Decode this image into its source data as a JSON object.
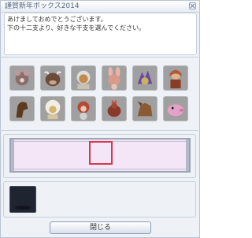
{
  "window": {
    "title": "謹賀新年ボックス2014"
  },
  "message": {
    "line1": "あけましておめでとうございます。",
    "line2": "下の十二支より、好きな干支を選んでください。"
  },
  "zodiac_icons": [
    {
      "icon": "rat-icon",
      "bg": "#9a9a9a",
      "accent": "#8a6d6d"
    },
    {
      "icon": "ox-icon",
      "bg": "#9a9a9a",
      "accent": "#6b4b3a"
    },
    {
      "icon": "tiger-icon",
      "bg": "#9a9a9a",
      "accent": "#c58a48"
    },
    {
      "icon": "rabbit-icon",
      "bg": "#9a9a9a",
      "accent": "#d99a8b"
    },
    {
      "icon": "dragon-icon",
      "bg": "#9a9a9a",
      "accent": "#6a4aa3"
    },
    {
      "icon": "snake-icon",
      "bg": "#9a9a9a",
      "accent": "#b05a3a"
    },
    {
      "icon": "horse-icon",
      "bg": "#9a9a9a",
      "accent": "#5c3a1f"
    },
    {
      "icon": "sheep-icon",
      "bg": "#9a9a9a",
      "accent": "#d7b36b"
    },
    {
      "icon": "monkey-icon",
      "bg": "#9a9a9a",
      "accent": "#b24a3a"
    },
    {
      "icon": "rooster-icon",
      "bg": "#9a9a9a",
      "accent": "#8a3a2a"
    },
    {
      "icon": "dog-icon",
      "bg": "#9a9a9a",
      "accent": "#8a5a34"
    },
    {
      "icon": "boar-icon",
      "bg": "#9a9a9a",
      "accent": "#e6a1c7"
    }
  ],
  "buttons": {
    "close_label": "閉じる"
  },
  "colors": {
    "selection_border": "#d33a4b",
    "track_fill": "#efe0f2"
  }
}
